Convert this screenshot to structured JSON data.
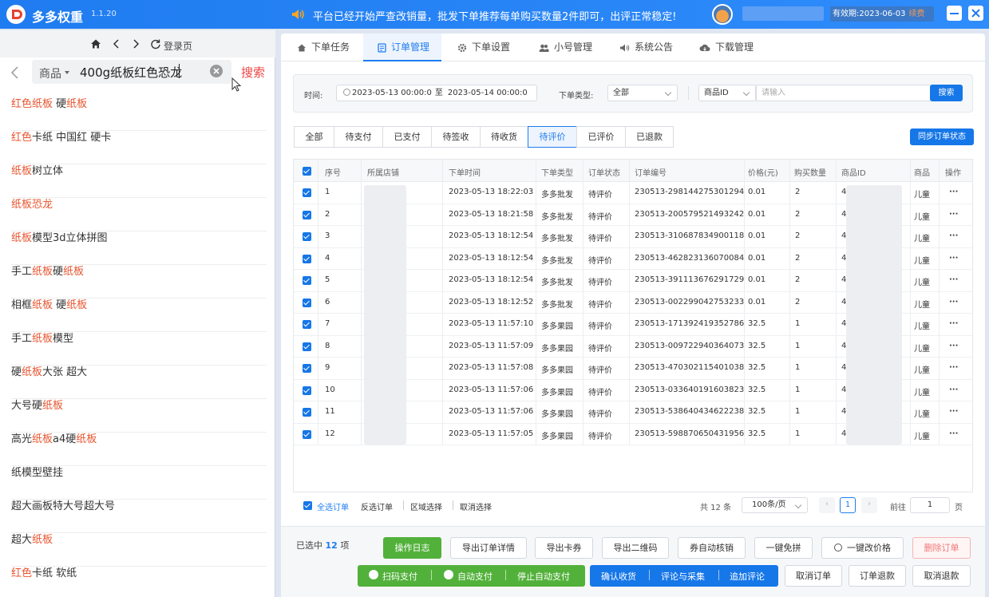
{
  "app": {
    "name": "多多权重",
    "version": "1.1.20",
    "notice": "平台已经开始严查改销量，批发下单推荐每单购买数量2件即可，出评正常稳定!",
    "validity": "有效期:2023-06-03",
    "renew": "续费"
  },
  "browser": {
    "login_label": "登录页",
    "search_category": "商品",
    "search_query": "400g纸板红色恐龙",
    "search_button": "搜索",
    "suggestions": [
      {
        "parts": [
          {
            "t": "红色纸板",
            "h": true
          },
          {
            "t": " 硬",
            "h": false
          },
          {
            "t": "纸板",
            "h": true
          }
        ]
      },
      {
        "parts": [
          {
            "t": "红色",
            "h": true
          },
          {
            "t": "卡纸 中国红 硬卡",
            "h": false
          }
        ]
      },
      {
        "parts": [
          {
            "t": "纸板",
            "h": true
          },
          {
            "t": "树立体",
            "h": false
          }
        ]
      },
      {
        "parts": [
          {
            "t": "纸板恐龙",
            "h": true
          }
        ]
      },
      {
        "parts": [
          {
            "t": "纸板",
            "h": true
          },
          {
            "t": "模型3d立体拼图",
            "h": false
          }
        ]
      },
      {
        "parts": [
          {
            "t": "手工",
            "h": false
          },
          {
            "t": "纸板",
            "h": true
          },
          {
            "t": "硬",
            "h": false
          },
          {
            "t": "纸板",
            "h": true
          }
        ]
      },
      {
        "parts": [
          {
            "t": "相框",
            "h": false
          },
          {
            "t": "纸板",
            "h": true
          },
          {
            "t": " 硬",
            "h": false
          },
          {
            "t": "纸板",
            "h": true
          }
        ]
      },
      {
        "parts": [
          {
            "t": "手工",
            "h": false
          },
          {
            "t": "纸板",
            "h": true
          },
          {
            "t": "模型",
            "h": false
          }
        ]
      },
      {
        "parts": [
          {
            "t": "硬",
            "h": false
          },
          {
            "t": "纸板",
            "h": true
          },
          {
            "t": "大张 超大",
            "h": false
          }
        ]
      },
      {
        "parts": [
          {
            "t": "大号硬",
            "h": false
          },
          {
            "t": "纸板",
            "h": true
          }
        ]
      },
      {
        "parts": [
          {
            "t": "高光",
            "h": false
          },
          {
            "t": "纸板",
            "h": true
          },
          {
            "t": "a4硬",
            "h": false
          },
          {
            "t": "纸板",
            "h": true
          }
        ]
      },
      {
        "parts": [
          {
            "t": "纸模型壁挂",
            "h": false
          }
        ]
      },
      {
        "parts": [
          {
            "t": "超大画板特大号超大号",
            "h": false
          }
        ]
      },
      {
        "parts": [
          {
            "t": "超大",
            "h": false
          },
          {
            "t": "纸板",
            "h": true
          }
        ]
      },
      {
        "parts": [
          {
            "t": "红色",
            "h": true
          },
          {
            "t": "卡纸 软纸",
            "h": false
          }
        ]
      }
    ]
  },
  "tabs": [
    "下单任务",
    "订单管理",
    "下单设置",
    "小号管理",
    "系统公告",
    "下载管理"
  ],
  "filter": {
    "time_label": "时间:",
    "time_start": "2023-05-13 00:00:0",
    "time_sep": "至",
    "time_end": "2023-05-14 00:00:0",
    "type_label": "下单类型:",
    "type_value": "全部",
    "id_select": "商品ID",
    "id_placeholder": "请输入",
    "search_button": "搜索"
  },
  "status_tabs": [
    "全部",
    "待支付",
    "已支付",
    "待签收",
    "待收货",
    "待评价",
    "已评价",
    "已退款"
  ],
  "sync_button": "同步订单状态",
  "table": {
    "headers": [
      "序号",
      "所属店铺",
      "下单时间",
      "下单类型",
      "订单状态",
      "订单编号",
      "价格(元)",
      "购买数量",
      "商品ID",
      "商品",
      "操作"
    ],
    "rows": [
      {
        "no": "1",
        "time": "2023-05-13 18:22:03",
        "type": "多多批发",
        "status": "待评价",
        "order": "230513-298144275301294",
        "price": "0.01",
        "qty": "2",
        "gid": "4",
        "goods": "儿童",
        "op": "···"
      },
      {
        "no": "2",
        "time": "2023-05-13 18:21:58",
        "type": "多多批发",
        "status": "待评价",
        "order": "230513-200579521493242",
        "price": "0.01",
        "qty": "2",
        "gid": "4",
        "goods": "儿童",
        "op": "···"
      },
      {
        "no": "3",
        "time": "2023-05-13 18:12:54",
        "type": "多多批发",
        "status": "待评价",
        "order": "230513-310687834900118",
        "price": "0.01",
        "qty": "2",
        "gid": "4",
        "goods": "儿童",
        "op": "···"
      },
      {
        "no": "4",
        "time": "2023-05-13 18:12:54",
        "type": "多多批发",
        "status": "待评价",
        "order": "230513-462823136070084",
        "price": "0.01",
        "qty": "2",
        "gid": "4",
        "goods": "儿童",
        "op": "···"
      },
      {
        "no": "5",
        "time": "2023-05-13 18:12:54",
        "type": "多多批发",
        "status": "待评价",
        "order": "230513-391113676291729",
        "price": "0.01",
        "qty": "2",
        "gid": "4",
        "goods": "儿童",
        "op": "···"
      },
      {
        "no": "6",
        "time": "2023-05-13 18:12:52",
        "type": "多多批发",
        "status": "待评价",
        "order": "230513-002299042753233",
        "price": "0.01",
        "qty": "2",
        "gid": "4",
        "goods": "儿童",
        "op": "···"
      },
      {
        "no": "7",
        "time": "2023-05-13 11:57:10",
        "type": "多多果园",
        "status": "待评价",
        "order": "230513-171392419352786",
        "price": "32.5",
        "qty": "1",
        "gid": "4",
        "goods": "儿童",
        "op": "···"
      },
      {
        "no": "8",
        "time": "2023-05-13 11:57:09",
        "type": "多多果园",
        "status": "待评价",
        "order": "230513-009722940364073",
        "price": "32.5",
        "qty": "1",
        "gid": "4",
        "goods": "儿童",
        "op": "···"
      },
      {
        "no": "9",
        "time": "2023-05-13 11:57:08",
        "type": "多多果园",
        "status": "待评价",
        "order": "230513-470302115401038",
        "price": "32.5",
        "qty": "1",
        "gid": "4",
        "goods": "儿童",
        "op": "···"
      },
      {
        "no": "10",
        "time": "2023-05-13 11:57:06",
        "type": "多多果园",
        "status": "待评价",
        "order": "230513-033640191603823",
        "price": "32.5",
        "qty": "1",
        "gid": "4",
        "goods": "儿童",
        "op": "···"
      },
      {
        "no": "11",
        "time": "2023-05-13 11:57:06",
        "type": "多多果园",
        "status": "待评价",
        "order": "230513-538640434622238",
        "price": "32.5",
        "qty": "1",
        "gid": "4",
        "goods": "儿童",
        "op": "···"
      },
      {
        "no": "12",
        "time": "2023-05-13 11:57:05",
        "type": "多多果园",
        "status": "待评价",
        "order": "230513-598870650431956",
        "price": "32.5",
        "qty": "1",
        "gid": "4",
        "goods": "儿童",
        "op": "···"
      }
    ]
  },
  "footer": {
    "select_all": "全选订单",
    "invert": "反选订单",
    "range": "区域选择",
    "cancel": "取消选择",
    "total": "共 12 条",
    "page_size": "100条/页",
    "page": "1",
    "goto_label": "前往",
    "goto_value": "1",
    "page_unit": "页"
  },
  "actions": {
    "selected_prefix": "已选中",
    "selected_count": "12",
    "selected_suffix": "项",
    "log": "操作日志",
    "export_detail": "导出订单详情",
    "export_card": "导出卡券",
    "export_qr": "导出二维码",
    "auto_verify": "券自动核销",
    "one_click_free": "一键免拼",
    "one_click_price": "一键改价格",
    "delete_order": "删除订单",
    "scan_pay": "扫码支付",
    "auto_pay": "自动支付",
    "stop_auto_pay": "停止自动支付",
    "confirm_receipt": "确认收货",
    "review_collect": "评论与采集",
    "append_review": "追加评论",
    "cancel_order": "取消订单",
    "refund_order": "订单退款",
    "cancel_refund": "取消退款"
  },
  "colors": {
    "primary": "#1677e8",
    "green": "#52b13a",
    "highlight": "#e8552f",
    "danger": "#f27878"
  }
}
